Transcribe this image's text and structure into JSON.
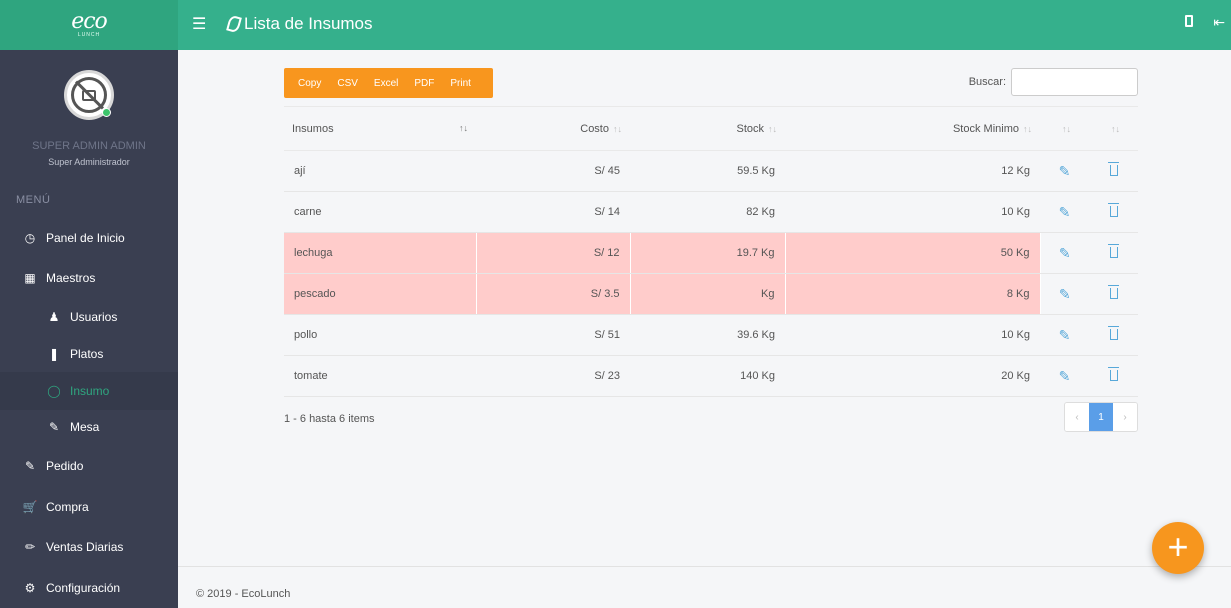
{
  "brand": {
    "logo": "eco",
    "sub": "LUNCH"
  },
  "header": {
    "title": "Lista de Insumos"
  },
  "user": {
    "name": "SUPER ADMIN ADMIN",
    "role": "Super Administrador"
  },
  "sidebar": {
    "menu_header": "MENÚ",
    "items": [
      {
        "label": "Panel de Inicio",
        "icon": "dashboard-icon"
      },
      {
        "label": "Maestros",
        "icon": "grid-icon"
      },
      {
        "label": "Usuarios",
        "icon": "users-icon"
      },
      {
        "label": "Platos",
        "icon": "cutlery-icon"
      },
      {
        "label": "Insumo",
        "icon": "leaf-icon"
      },
      {
        "label": "Mesa",
        "icon": "edit-icon"
      },
      {
        "label": "Pedido",
        "icon": "edit-icon"
      },
      {
        "label": "Compra",
        "icon": "cart-icon"
      },
      {
        "label": "Ventas Diarias",
        "icon": "pencil-icon"
      },
      {
        "label": "Configuración",
        "icon": "gear-icon"
      }
    ]
  },
  "toolbar": {
    "copy": "Copy",
    "csv": "CSV",
    "excel": "Excel",
    "pdf": "PDF",
    "print": "Print"
  },
  "search": {
    "label": "Buscar:"
  },
  "table": {
    "headers": [
      "Insumos",
      "Costo",
      "Stock",
      "Stock Minimo"
    ],
    "rows": [
      {
        "insumo": "ají",
        "costo": "S/ 45",
        "stock": "59.5 Kg",
        "minimo": "12 Kg",
        "warn": false
      },
      {
        "insumo": "carne",
        "costo": "S/ 14",
        "stock": "82 Kg",
        "minimo": "10 Kg",
        "warn": false
      },
      {
        "insumo": "lechuga",
        "costo": "S/ 12",
        "stock": "19.7 Kg",
        "minimo": "50 Kg",
        "warn": true
      },
      {
        "insumo": "pescado",
        "costo": "S/ 3.5",
        "stock": "Kg",
        "minimo": "8 Kg",
        "warn": true
      },
      {
        "insumo": "pollo",
        "costo": "S/ 51",
        "stock": "39.6 Kg",
        "minimo": "10 Kg",
        "warn": false
      },
      {
        "insumo": "tomate",
        "costo": "S/ 23",
        "stock": "140 Kg",
        "minimo": "20 Kg",
        "warn": false
      }
    ]
  },
  "summary": "1 - 6 hasta 6 items",
  "pagination": {
    "prev": "‹",
    "current": "1",
    "next": "›"
  },
  "footer": "© 2019 - EcoLunch",
  "colors": {
    "accent": "#35b08c",
    "sidebar": "#3a3f51",
    "orange": "#f8961e",
    "warn_row": "#ffcccb"
  }
}
